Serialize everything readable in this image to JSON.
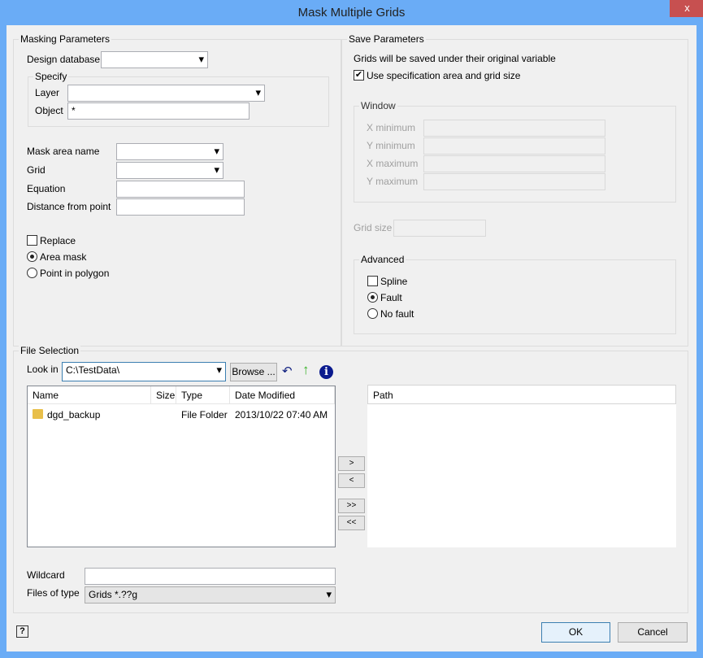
{
  "window": {
    "title": "Mask Multiple Grids",
    "close": "x"
  },
  "masking": {
    "legend": "Masking Parameters",
    "design_database_label": "Design database",
    "design_database_value": "",
    "specify": {
      "legend": "Specify",
      "layer_label": "Layer",
      "layer_value": "",
      "object_label": "Object",
      "object_value": "*"
    },
    "mask_area_label": "Mask area name",
    "grid_label": "Grid",
    "equation_label": "Equation",
    "distance_label": "Distance from point",
    "replace_label": "Replace",
    "replace_checked": false,
    "area_mask_label": "Area mask",
    "point_in_polygon_label": "Point in polygon",
    "selected_mode": "Area mask"
  },
  "save": {
    "legend": "Save Parameters",
    "note": "Grids will be saved under their original variable",
    "use_spec_label": "Use specification area and grid size",
    "use_spec_checked": true,
    "window": {
      "legend": "Window",
      "xmin": "X minimum",
      "ymin": "Y minimum",
      "xmax": "X maximum",
      "ymax": "Y maximum"
    },
    "grid_size_label": "Grid size",
    "advanced": {
      "legend": "Advanced",
      "spline": "Spline",
      "spline_checked": false,
      "fault": "Fault",
      "no_fault": "No fault",
      "selected": "Fault"
    }
  },
  "files": {
    "legend": "File Selection",
    "look_in_label": "Look in",
    "look_in_value": "C:\\TestData\\",
    "browse": "Browse ...",
    "columns": [
      "Name",
      "Size",
      "Type",
      "Date Modified"
    ],
    "rows": [
      {
        "name": "dgd_backup",
        "size": "",
        "type": "File Folder",
        "date": "2013/10/22 07:40 AM"
      }
    ],
    "path_header": "Path",
    "add": ">",
    "remove": "<",
    "add_all": ">>",
    "remove_all": "<<",
    "wildcard_label": "Wildcard",
    "wildcard_value": "",
    "files_of_type_label": "Files of type",
    "files_of_type_value": "Grids *.??g"
  },
  "footer": {
    "ok": "OK",
    "cancel": "Cancel"
  }
}
